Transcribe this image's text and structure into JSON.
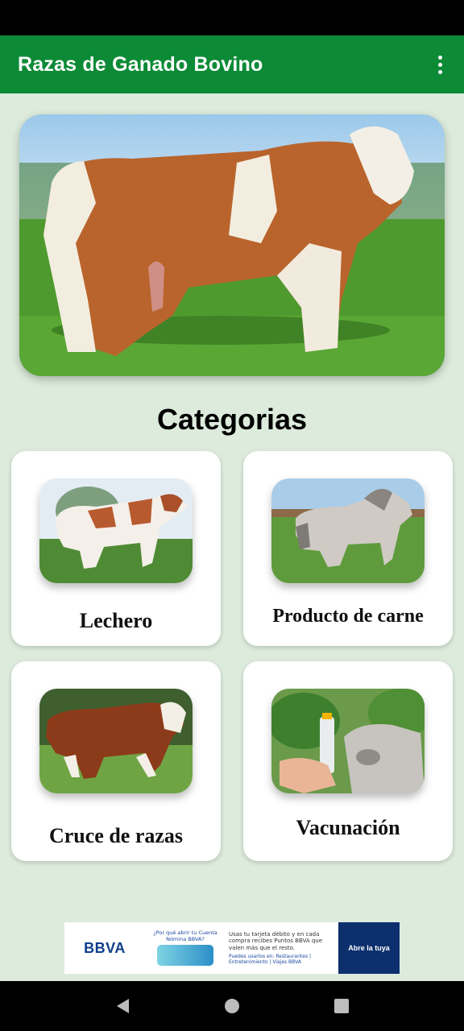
{
  "app_bar": {
    "title": "Razas de Ganado Bovino",
    "menu_icon": "more-vert-icon"
  },
  "hero": {
    "image": "simmental-bull-photo"
  },
  "section_title": "Categorias",
  "categories": [
    {
      "label": "Lechero",
      "image": "holstein-dairy-cow-photo"
    },
    {
      "label": "Producto de carne",
      "image": "brahman-bull-photo"
    },
    {
      "label": "Cruce de razas",
      "image": "hereford-bull-photo"
    },
    {
      "label": "Vacunación",
      "image": "cow-vaccination-photo"
    }
  ],
  "ad": {
    "brand": "BBVA",
    "question": "¿Por qué abrir tu Cuenta Nómina BBVA?",
    "copy": "Usas tu tarjeta débito y en cada compra recibes Puntos BBVA que valen más que el resto.",
    "fine_print": "Puedes usarlos en: Restaurantes | Entretenimiento | Viajes BBVA",
    "cta": "Abre la tuya"
  },
  "nav": {
    "back_icon": "back-triangle-icon",
    "home_icon": "home-circle-icon",
    "recents_icon": "recents-square-icon"
  },
  "colors": {
    "primary": "#0c8a36",
    "background": "#dcebdc",
    "card": "#ffffff"
  }
}
